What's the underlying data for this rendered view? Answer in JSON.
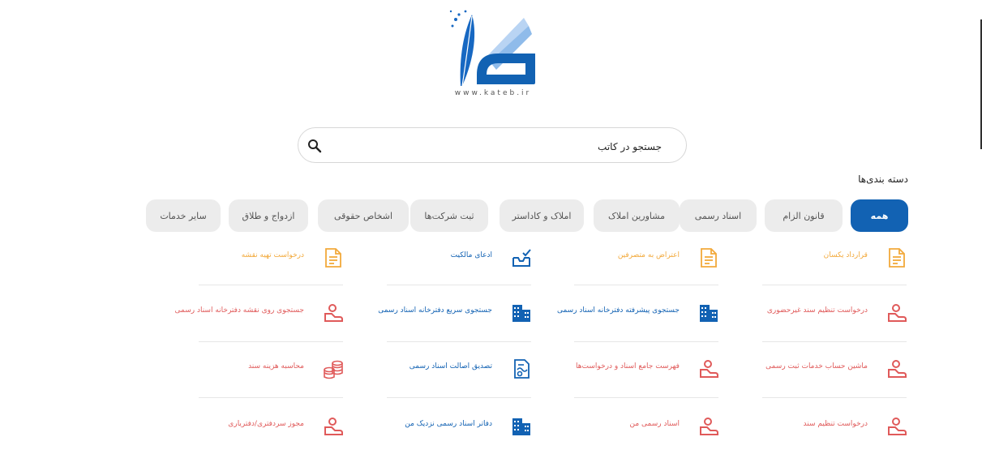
{
  "logo": {
    "url_text": "www.kateb.ir"
  },
  "search": {
    "placeholder": "جستجو در کاتب"
  },
  "categories_title": "دسته بندی‌ها",
  "categories": [
    {
      "label": "همه",
      "active": true
    },
    {
      "label": "قانون الزام",
      "active": false
    },
    {
      "label": "اسناد رسمی",
      "active": false
    },
    {
      "label": "مشاورین املاک",
      "active": false
    },
    {
      "label": "املاک و کاداستر",
      "active": false
    },
    {
      "label": "ثبت شرکت‌ها",
      "active": false
    },
    {
      "label": "اشخاص حقوقی",
      "active": false
    },
    {
      "label": "ازدواج و طلاق",
      "active": false
    },
    {
      "label": "سایر خدمات",
      "active": false
    }
  ],
  "services": [
    [
      {
        "label": "قرارداد یکسان",
        "icon": "document-icon",
        "color": "orange"
      },
      {
        "label": "اعتراض به متصرفین",
        "icon": "document-icon",
        "color": "orange"
      },
      {
        "label": "ادعای مالکیت",
        "icon": "inbox-check-icon",
        "color": "blue"
      },
      {
        "label": "درخواست تهیه نقشه",
        "icon": "document-icon",
        "color": "orange"
      }
    ],
    [
      {
        "label": "درخواست تنظیم سند غیرحضوری",
        "icon": "hand-person-icon",
        "color": "red"
      },
      {
        "label": "جستجوی پیشرفته دفترخانه اسناد رسمی",
        "icon": "building-icon",
        "color": "blue"
      },
      {
        "label": "جستجوی سریع دفترخانه اسناد رسمی",
        "icon": "building-icon",
        "color": "blue"
      },
      {
        "label": "جستجوی روی نقشه دفترخانه اسناد رسمی",
        "icon": "hand-person-icon",
        "color": "red"
      }
    ],
    [
      {
        "label": "ماشین حساب خدمات ثبت رسمی",
        "icon": "hand-person-icon",
        "color": "red"
      },
      {
        "label": "فهرست جامع اسناد و درخواست‌ها",
        "icon": "hand-person-icon",
        "color": "red"
      },
      {
        "label": "تصدیق اصالت اسناد رسمی",
        "icon": "certificate-icon",
        "color": "blue"
      },
      {
        "label": "محاسبه هزینه سند",
        "icon": "coins-icon",
        "color": "red"
      }
    ],
    [
      {
        "label": "درخواست تنظیم سند",
        "icon": "hand-person-icon",
        "color": "red"
      },
      {
        "label": "اسناد رسمی من",
        "icon": "hand-person-icon",
        "color": "red"
      },
      {
        "label": "دفاتر اسناد رسمی نزدیک من",
        "icon": "building-icon",
        "color": "blue"
      },
      {
        "label": "مجوز سردفتری/دفتریاری",
        "icon": "hand-person-icon",
        "color": "red"
      }
    ]
  ]
}
